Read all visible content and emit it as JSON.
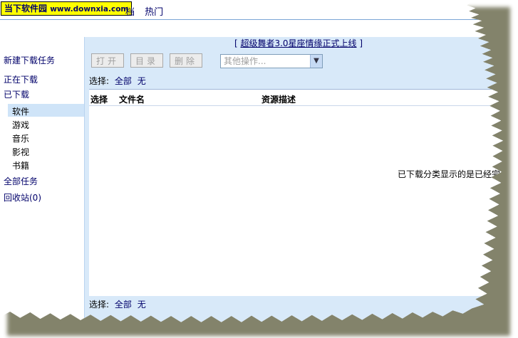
{
  "header": {
    "logo_text": "当下软件园",
    "logo_url": "www.downxia.com",
    "nav": [
      "档",
      "热门"
    ]
  },
  "sidebar": {
    "items": [
      {
        "label": "新建下载任务"
      },
      {
        "label": "正在下载"
      },
      {
        "label": "已下载"
      }
    ],
    "sub_items": [
      "软件",
      "游戏",
      "音乐",
      "影视",
      "书籍"
    ],
    "selected_sub": "软件",
    "more_items": [
      {
        "label": "全部任务"
      },
      {
        "label": "回收站(0)"
      }
    ]
  },
  "main": {
    "banner": {
      "open": "[",
      "link": "超级舞者3.0星座情缘正式上线",
      "close": "]"
    },
    "toolbar": {
      "open_label": "打开",
      "dir_label": "目录",
      "delete_label": "删除",
      "other_ops": "其他操作..."
    },
    "selection": {
      "label": "选择:",
      "all": "全部",
      "none": "无"
    },
    "columns": [
      "选择",
      "文件名",
      "资源描述"
    ],
    "notice": "已下载分类显示的是已经完",
    "bottom_selection": {
      "label": "选择:",
      "all": "全部",
      "none": "无"
    }
  }
}
